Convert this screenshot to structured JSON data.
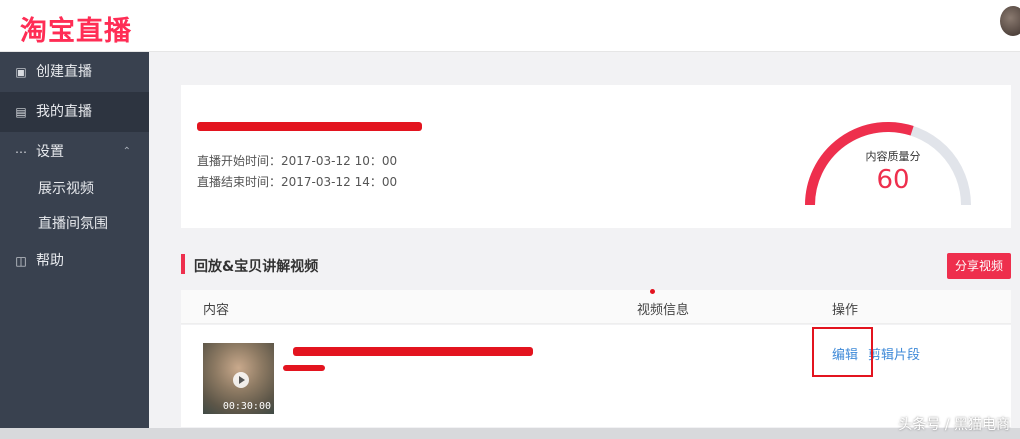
{
  "header": {
    "logo_text": "淘宝直播"
  },
  "sidebar": {
    "items": [
      {
        "label": "创建直播",
        "icon": "video-icon"
      },
      {
        "label": "我的直播",
        "icon": "list-icon"
      },
      {
        "label": "设置",
        "icon": "dots-icon"
      },
      {
        "label": "展示视频"
      },
      {
        "label": "直播间氛围"
      },
      {
        "label": "帮助",
        "icon": "book-icon"
      }
    ]
  },
  "live_card": {
    "title_redacted": true,
    "start_label": "直播开始时间：",
    "start_time": "2017-03-12 10：00",
    "end_label": "直播结束时间：",
    "end_time": "2017-03-12 14：00",
    "quality_label": "内容质量分",
    "quality_score": "60",
    "quality_fraction": 0.6
  },
  "section": {
    "title": "回放&宝贝讲解视频",
    "share_button": "分享视频"
  },
  "table": {
    "columns": [
      "内容",
      "视频信息",
      "操作"
    ],
    "rows": [
      {
        "duration": "00:30:00",
        "actions": [
          "编辑",
          "剪辑片段"
        ]
      }
    ]
  },
  "watermark": "头条号 / 黑猫电商",
  "colors": {
    "accent": "#ee2f4d",
    "sidebar": "#39414f",
    "link": "#3f8ad8"
  }
}
